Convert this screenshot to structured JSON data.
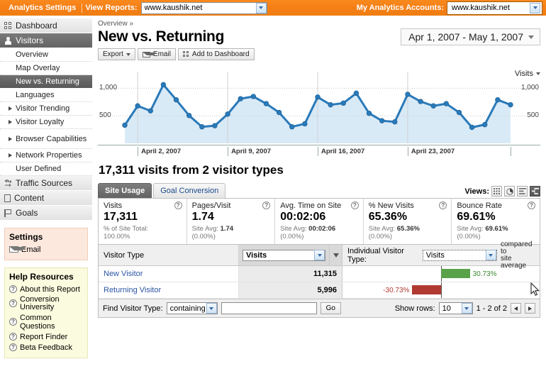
{
  "topbar": {
    "analytics_settings": "Analytics Settings",
    "view_reports_label": "View Reports:",
    "view_reports_value": "www.kaushik.net",
    "my_accounts_label": "My Analytics Accounts:",
    "my_accounts_value": "www.kaushik.net",
    "bg_color": "#f7821b"
  },
  "sidebar": {
    "nav": [
      {
        "label": "Dashboard",
        "icon": "dashboard-icon",
        "active": false
      },
      {
        "label": "Visitors",
        "icon": "visitors-icon",
        "active": true
      }
    ],
    "visitors_sub": [
      {
        "label": "Overview",
        "expandable": false,
        "selected": false
      },
      {
        "label": "Map Overlay",
        "expandable": false,
        "selected": false
      },
      {
        "label": "New vs. Returning",
        "expandable": false,
        "selected": true
      },
      {
        "label": "Languages",
        "expandable": false,
        "selected": false
      },
      {
        "label": "Visitor Trending",
        "expandable": true,
        "selected": false
      },
      {
        "label": "Visitor Loyalty",
        "expandable": true,
        "selected": false
      },
      {
        "label": "Browser Capabilities",
        "expandable": true,
        "selected": false
      },
      {
        "label": "Network Properties",
        "expandable": true,
        "selected": false
      },
      {
        "label": "User Defined",
        "expandable": false,
        "selected": false
      }
    ],
    "nav_bottom": [
      {
        "label": "Traffic Sources",
        "icon": "traffic-sources-icon"
      },
      {
        "label": "Content",
        "icon": "content-icon"
      },
      {
        "label": "Goals",
        "icon": "goals-icon"
      }
    ],
    "settings_panel": {
      "title": "Settings",
      "items": [
        {
          "label": "Email",
          "icon": "envelope-icon"
        }
      ]
    },
    "help_panel": {
      "title": "Help Resources",
      "items": [
        {
          "label": "About this Report"
        },
        {
          "label": "Conversion University"
        },
        {
          "label": "Common Questions"
        },
        {
          "label": "Report Finder"
        },
        {
          "label": "Beta Feedback"
        }
      ]
    }
  },
  "main": {
    "breadcrumb": "Overview »",
    "page_title": "New vs. Returning",
    "date_range": "Apr 1, 2007 - May 1, 2007",
    "buttons": [
      {
        "label": "Export",
        "icon": "caret-down-icon"
      },
      {
        "label": "Email",
        "icon": "envelope-icon"
      },
      {
        "label": "Add to Dashboard",
        "icon": "dashboard-icon"
      }
    ],
    "metric_selector": "Visits",
    "summary": "17,311 visits from 2 visitor types",
    "tabs": [
      {
        "label": "Site Usage",
        "active": true
      },
      {
        "label": "Goal Conversion",
        "active": false
      }
    ],
    "views_label": "Views:",
    "view_buttons": [
      {
        "name": "table-view-icon",
        "active": false
      },
      {
        "name": "pie-view-icon",
        "active": false
      },
      {
        "name": "bar-view-icon",
        "active": false
      },
      {
        "name": "comparison-view-icon",
        "active": true
      }
    ],
    "metrics": [
      {
        "label": "Visits",
        "value": "17,311",
        "sub_label": "% of Site Total:",
        "sub_value": "100.00%"
      },
      {
        "label": "Pages/Visit",
        "value": "1.74",
        "sub_label": "Site Avg:",
        "sub_value": "1.74",
        "sub_extra": "(0.00%)"
      },
      {
        "label": "Avg. Time on Site",
        "value": "00:02:06",
        "sub_label": "Site Avg:",
        "sub_value": "00:02:06",
        "sub_extra": "(0.00%)"
      },
      {
        "label": "% New Visits",
        "value": "65.36%",
        "sub_label": "Site Avg:",
        "sub_value": "65.36%",
        "sub_extra": "(0.00%)"
      },
      {
        "label": "Bounce Rate",
        "value": "69.61%",
        "sub_label": "Site Avg:",
        "sub_value": "69.61%",
        "sub_extra": "(0.00%)"
      }
    ],
    "table": {
      "col_dimension": "Visitor Type",
      "col_metric_select": "Visits",
      "individual_label": "Individual Visitor Type:",
      "individual_select": "Visits",
      "compared_to": "compared to",
      "site_average": "site average",
      "rows": [
        {
          "name": "New Visitor",
          "value": "11,315",
          "pct": "30.73%",
          "direction": "positive",
          "bar_color": "#5aa24a"
        },
        {
          "name": "Returning Visitor",
          "value": "5,996",
          "pct": "-30.73%",
          "direction": "negative",
          "bar_color": "#b03a32"
        }
      ],
      "find_label": "Find Visitor Type:",
      "find_operator": "containing",
      "find_value": "",
      "go_label": "Go",
      "show_rows_label": "Show rows:",
      "show_rows_value": "10",
      "range_label": "1 - 2 of 2"
    }
  },
  "chart_data": {
    "type": "line",
    "title": "",
    "metric": "Visits",
    "ylabel": "",
    "xlabel": "",
    "ylim": [
      0,
      1250
    ],
    "yticks": [
      500,
      1000
    ],
    "ytick_labels": [
      "500",
      "1,000"
    ],
    "grid": true,
    "legend_position": "none",
    "line_color": "#2a7ab9",
    "fill_color": "#d9eaf7",
    "xtick_labels": [
      "April 2, 2007",
      "April 9, 2007",
      "April 16, 2007",
      "April 23, 2007"
    ],
    "xtick_indices": [
      1,
      8,
      15,
      22
    ],
    "x": [
      "Apr 1, 2007",
      "Apr 2, 2007",
      "Apr 3, 2007",
      "Apr 4, 2007",
      "Apr 5, 2007",
      "Apr 6, 2007",
      "Apr 7, 2007",
      "Apr 8, 2007",
      "Apr 9, 2007",
      "Apr 10, 2007",
      "Apr 11, 2007",
      "Apr 12, 2007",
      "Apr 13, 2007",
      "Apr 14, 2007",
      "Apr 15, 2007",
      "Apr 16, 2007",
      "Apr 17, 2007",
      "Apr 18, 2007",
      "Apr 19, 2007",
      "Apr 20, 2007",
      "Apr 21, 2007",
      "Apr 22, 2007",
      "Apr 23, 2007",
      "Apr 24, 2007",
      "Apr 25, 2007",
      "Apr 26, 2007",
      "Apr 27, 2007",
      "Apr 28, 2007",
      "Apr 29, 2007",
      "Apr 30, 2007",
      "May 1, 2007"
    ],
    "values": [
      330,
      680,
      590,
      1065,
      790,
      505,
      300,
      320,
      530,
      810,
      850,
      720,
      560,
      300,
      355,
      840,
      700,
      730,
      910,
      545,
      410,
      390,
      890,
      760,
      680,
      720,
      560,
      290,
      340,
      790,
      700
    ]
  }
}
